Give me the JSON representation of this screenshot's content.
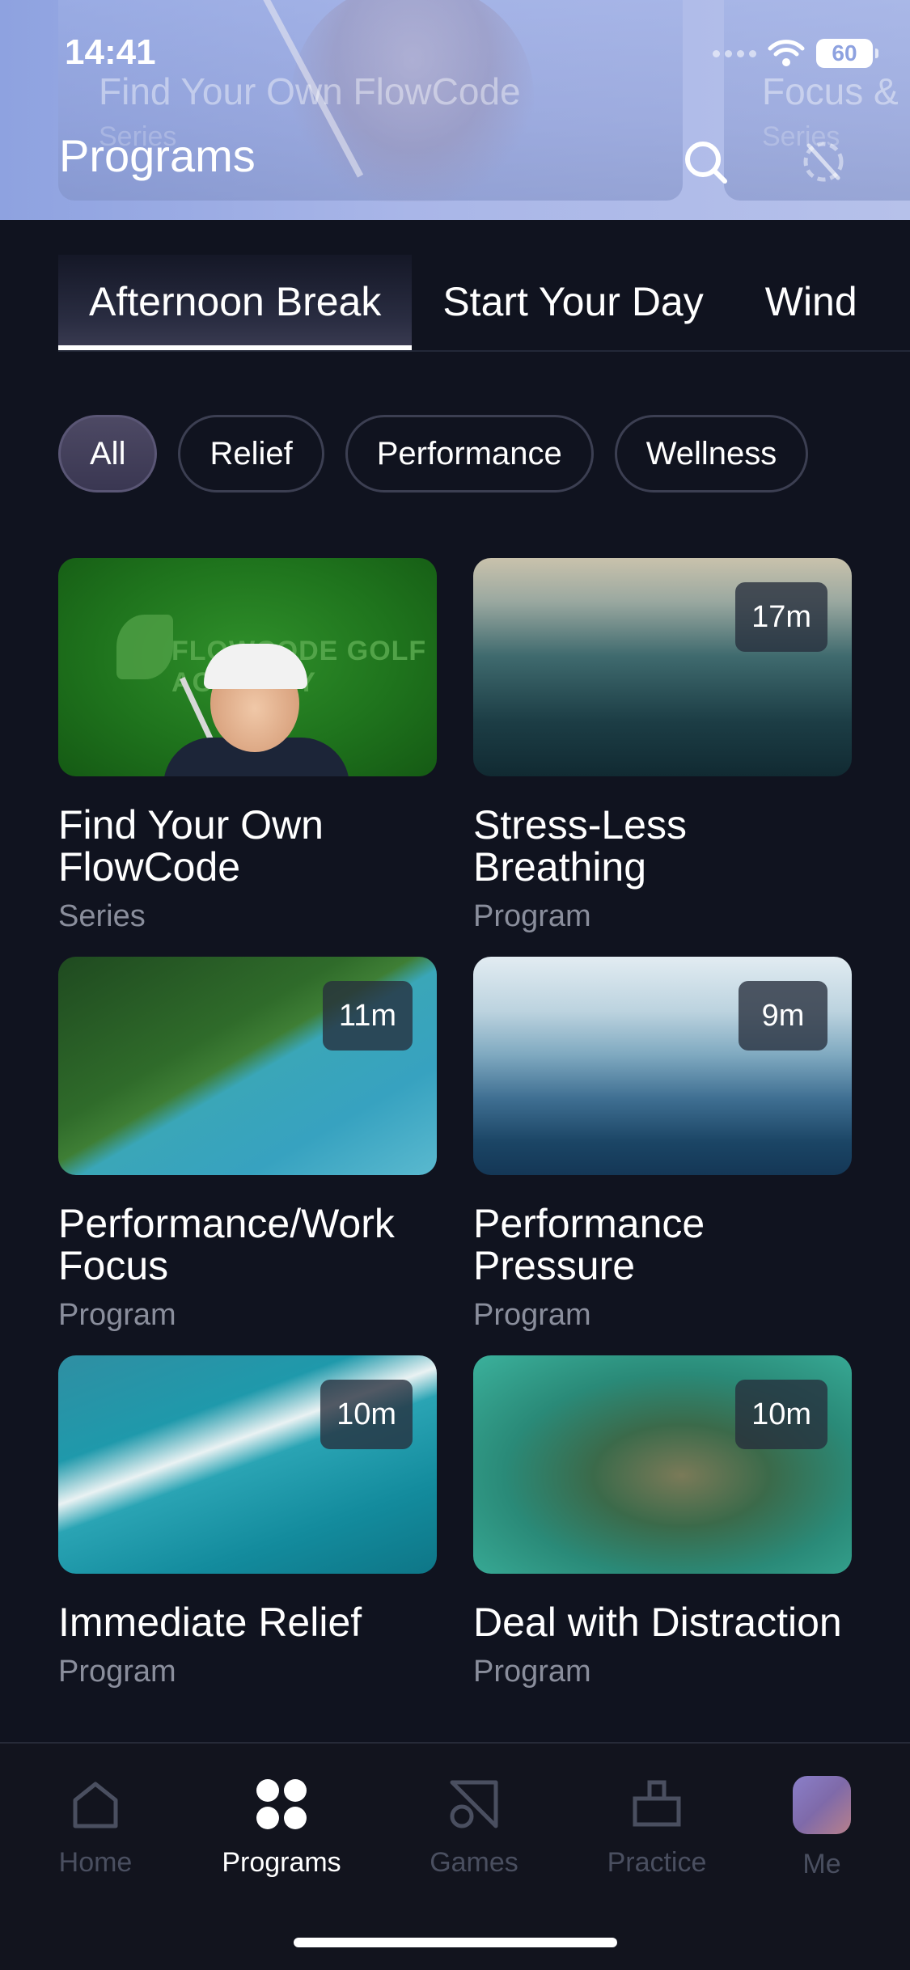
{
  "status_bar": {
    "time": "14:41",
    "battery": "60"
  },
  "header": {
    "title": "Programs",
    "background_cards": [
      {
        "title": "Find Your Own FlowCode",
        "subtitle": "Series"
      },
      {
        "title": "Focus &",
        "subtitle": "Series"
      }
    ],
    "icons": [
      "search-icon",
      "do-not-disturb-icon"
    ]
  },
  "tabs": [
    {
      "label": "Afternoon Break",
      "active": true
    },
    {
      "label": "Start Your Day",
      "active": false
    },
    {
      "label": "Wind",
      "active": false
    }
  ],
  "filters": [
    {
      "label": "All",
      "active": true
    },
    {
      "label": "Relief",
      "active": false
    },
    {
      "label": "Performance",
      "active": false
    },
    {
      "label": "Wellness",
      "active": false
    }
  ],
  "cards": [
    {
      "title": "Find Your Own FlowCode",
      "type": "Series",
      "duration": "",
      "thumb_logo": "FLOWCODE GOLF ACADEMY"
    },
    {
      "title": "Stress-Less Breathing",
      "type": "Program",
      "duration": "17m"
    },
    {
      "title": "Performance/Work Focus",
      "type": "Program",
      "duration": "11m"
    },
    {
      "title": "Performance Pressure",
      "type": "Program",
      "duration": "9m"
    },
    {
      "title": "Immediate Relief",
      "type": "Program",
      "duration": "10m"
    },
    {
      "title": "Deal with Distraction",
      "type": "Program",
      "duration": "10m"
    }
  ],
  "bottom_nav": [
    {
      "label": "Home",
      "icon": "home-icon",
      "active": false
    },
    {
      "label": "Programs",
      "icon": "programs-grid-icon",
      "active": true
    },
    {
      "label": "Games",
      "icon": "games-icon",
      "active": false
    },
    {
      "label": "Practice",
      "icon": "practice-icon",
      "active": false
    },
    {
      "label": "Me",
      "icon": "avatar",
      "active": false
    }
  ],
  "colors": {
    "background": "#10131f",
    "header_gradient_start": "#8ea2e0",
    "muted_text": "#8a8e9c",
    "inactive_nav": "#4a4f60"
  }
}
